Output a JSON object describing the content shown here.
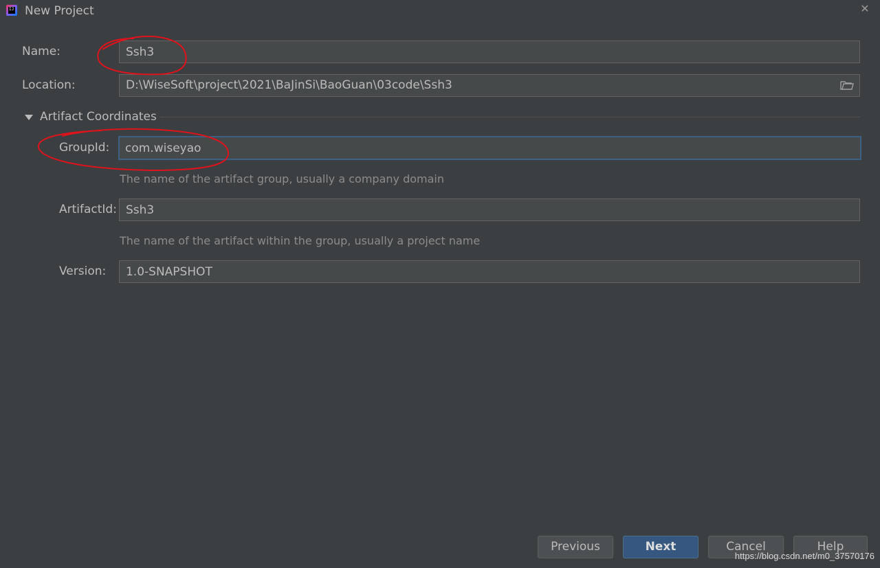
{
  "window": {
    "title": "New Project",
    "app_icon": "intellij-idea-icon",
    "close_glyph": "✕"
  },
  "form": {
    "name": {
      "label": "Name:",
      "value": "Ssh3"
    },
    "location": {
      "label": "Location:",
      "value": "D:\\WiseSoft\\project\\2021\\BaJinSi\\BaoGuan\\03code\\Ssh3",
      "icon": "folder-icon"
    },
    "artifact_section": {
      "title": "Artifact Coordinates",
      "expanded": true,
      "group_id": {
        "label": "GroupId:",
        "value": "com.wiseyao",
        "hint": "The name of the artifact group, usually a company domain"
      },
      "artifact_id": {
        "label": "ArtifactId:",
        "value": "Ssh3",
        "hint": "The name of the artifact within the group, usually a project name"
      },
      "version": {
        "label": "Version:",
        "value": "1.0-SNAPSHOT"
      }
    }
  },
  "buttons": {
    "previous": "Previous",
    "next": "Next",
    "cancel": "Cancel",
    "help": "Help"
  },
  "watermark": "https://blog.csdn.net/m0_37570176",
  "colors": {
    "background": "#3c3f41",
    "field_bg": "#45494a",
    "focus_border": "#3d6185",
    "primary_button": "#365880",
    "annotation": "#e0121b"
  }
}
